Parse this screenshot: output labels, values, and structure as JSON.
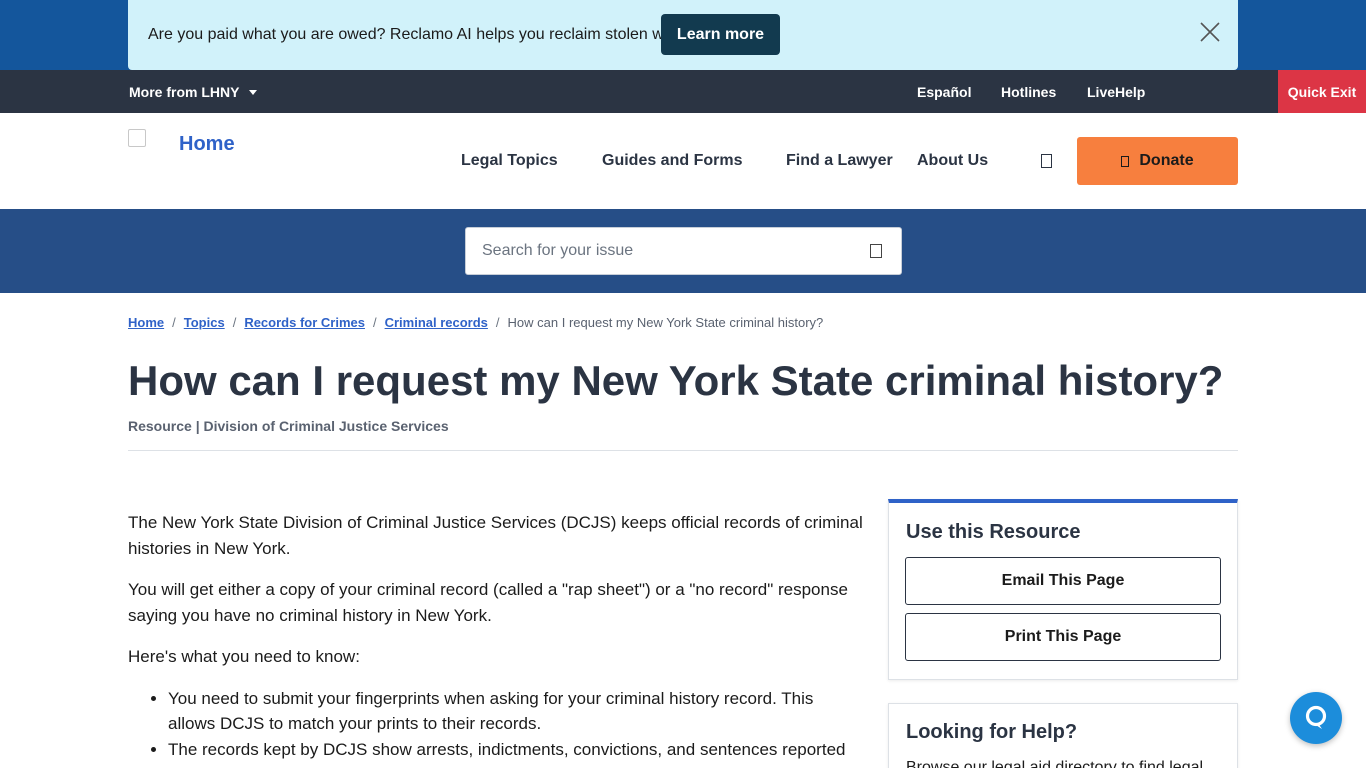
{
  "announcement": {
    "text": "Are you paid what you are owed? Reclamo AI helps you reclaim stolen wages.",
    "cta_label": "Learn more"
  },
  "utility_bar": {
    "more_label": "More from LHNY",
    "links": [
      "Español",
      "Hotlines",
      "LiveHelp"
    ],
    "quick_exit_label": "Quick Exit"
  },
  "header": {
    "logo_text": "Home",
    "nav": [
      "Legal Topics",
      "Guides and Forms",
      "Find a Lawyer",
      "About Us"
    ],
    "donate_label": "Donate"
  },
  "search": {
    "placeholder": "Search for your issue"
  },
  "breadcrumb": {
    "links": [
      "Home",
      "Topics",
      "Records for Crimes",
      "Criminal records"
    ],
    "current": "How can I request my New York State criminal history?"
  },
  "page": {
    "title": "How can I request my New York State criminal history?",
    "subtitle": "Resource | Division of Criminal Justice Services"
  },
  "content": {
    "paragraphs": [
      "The New York State Division of Criminal Justice Services (DCJS) keeps official records of criminal histories in New York.",
      "You will get either a copy of your criminal record (called a \"rap sheet\") or a \"no record\" response saying you have no criminal history in New York.",
      "Here's what you need to know:"
    ],
    "bullets": [
      "You need to submit your fingerprints when asking for your criminal history record. This allows DCJS to match your prints to their records.",
      "The records kept by DCJS show arrests, indictments, convictions, and sentences reported"
    ]
  },
  "sidebar": {
    "use_resource": {
      "title": "Use this Resource",
      "email_label": "Email This Page",
      "print_label": "Print This Page"
    },
    "help": {
      "title": "Looking for Help?",
      "text": "Browse our legal aid directory to find legal"
    }
  },
  "colors": {
    "brand_blue": "#14569c",
    "dark_navy": "#2b3443",
    "search_band": "#264e87",
    "donate_orange": "#f77f3e",
    "quick_exit_red": "#dc3545",
    "link_blue": "#2f62c8"
  },
  "icons": [
    "close-icon",
    "caret-down-icon",
    "search-icon",
    "donate-icon",
    "chat-icon"
  ]
}
